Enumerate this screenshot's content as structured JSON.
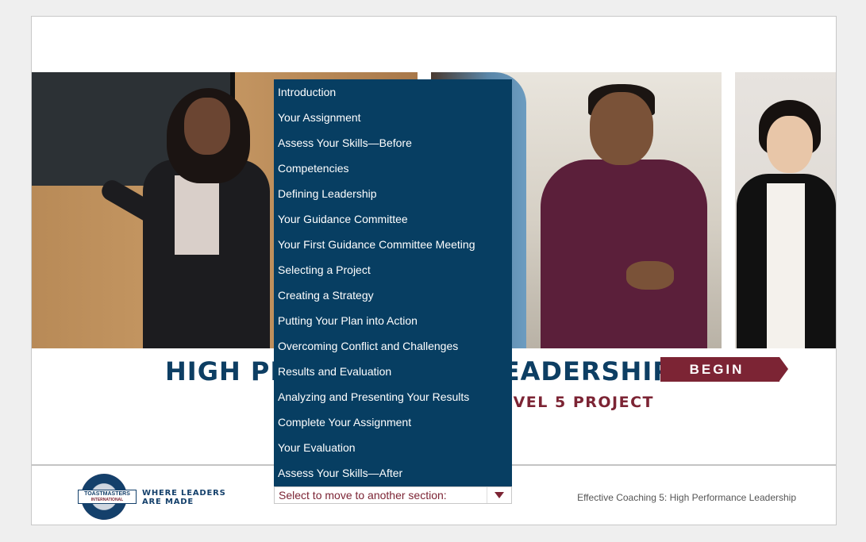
{
  "hero": {
    "title": "HIGH PERFORMANCE LEADERSHIP",
    "subtitle": "LEVEL 5 PROJECT",
    "begin_label": "BEGIN"
  },
  "menu": {
    "items": [
      "Introduction",
      "Your Assignment",
      "Assess Your Skills—Before",
      "Competencies",
      "Defining Leadership",
      "Your Guidance Committee",
      "Your First Guidance Committee Meeting",
      "Selecting a Project",
      "Creating a Strategy",
      "Putting Your Plan into Action",
      "Overcoming Conflict and Challenges",
      "Results and Evaluation",
      "Analyzing and Presenting Your Results",
      "Complete Your Assignment",
      "Your Evaluation",
      "Assess Your Skills—After"
    ],
    "select_placeholder": "Select to move to another section:"
  },
  "footer": {
    "logo_text": "TOASTMASTERS",
    "logo_subtext": "INTERNATIONAL",
    "tagline": "WHERE LEADERS ARE MADE",
    "course_title": "Effective Coaching 5: High Performance Leadership"
  },
  "colors": {
    "navy": "#073e62",
    "maroon": "#7c2434",
    "title_blue": "#0d3e63"
  },
  "icons": {
    "select_arrow": "triangle-down-icon",
    "begin_arrow": "chevron-right-icon"
  }
}
